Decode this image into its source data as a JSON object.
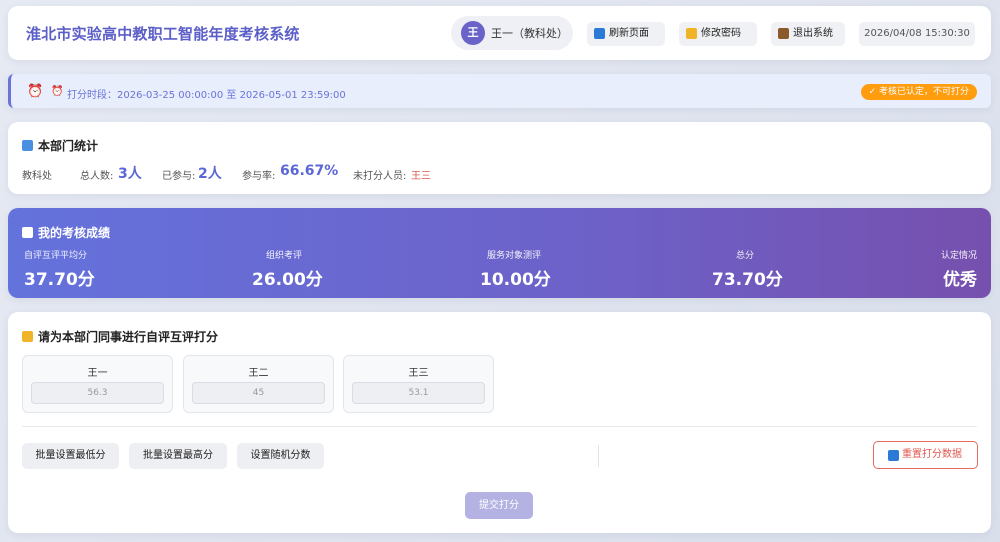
{
  "header": {
    "title": "淮北市实验高中教职工智能年度考核系统",
    "avatar_letter": "王",
    "user_name": "王一（教科处）",
    "refresh_label": "刷新页面",
    "password_label": "修改密码",
    "logout_label": "退出系统",
    "datetime": "2026/04/08 15:30:30"
  },
  "period": {
    "text": "打分时段：2026-03-25 00:00:00 至 2026-05-01 23:59:00",
    "status": "✓ 考核已认定，不可打分"
  },
  "dept_stats": {
    "title": "本部门统计",
    "dept_name": "教科处",
    "total_label": "总人数:",
    "total_value": "3人",
    "participated_label": "已参与:",
    "participated_value": "2人",
    "rate_label": "参与率:",
    "rate_value": "66.67%",
    "unscored_label": "未打分人员:",
    "unscored_value": "王三"
  },
  "score": {
    "title": "我的考核成绩",
    "items": [
      {
        "label": "自评互评平均分",
        "value": "37.70分"
      },
      {
        "label": "组织考评",
        "value": "26.00分"
      },
      {
        "label": "服务对象测评",
        "value": "10.00分"
      },
      {
        "label": "总分",
        "value": "73.70分"
      },
      {
        "label": "认定情况",
        "value": "优秀"
      }
    ]
  },
  "scoring": {
    "title": "请为本部门同事进行自评互评打分",
    "colleagues": [
      {
        "name": "王一",
        "score": "56.3"
      },
      {
        "name": "王二",
        "score": "45"
      },
      {
        "name": "王三",
        "score": "53.1"
      }
    ],
    "batch_min_label": "批量设置最低分",
    "batch_max_label": "批量设置最高分",
    "random_label": "设置随机分数",
    "reset_label": "重置打分数据",
    "submit_label": "提交打分"
  },
  "colors": {
    "accent": "#5b5fc7",
    "banner_start": "#6472dc",
    "banner_end": "#7650ae",
    "warning": "#ff9d0f",
    "danger": "#e0584f"
  }
}
